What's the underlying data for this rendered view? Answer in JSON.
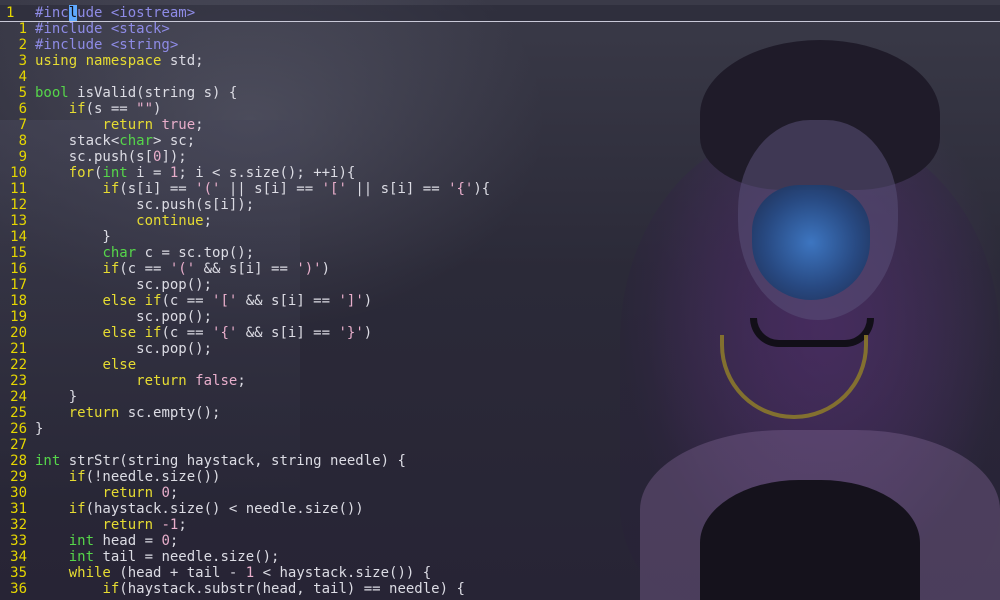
{
  "editor": {
    "colors": {
      "line_number": "#e5d600",
      "preprocessor": "#8e8be6",
      "keyword": "#e6dc32",
      "type": "#56d64a",
      "string": "#e8aecb",
      "plain": "#dcdce4",
      "cursor": "#5fa9ff"
    },
    "current_line": 0,
    "cursor": {
      "line": 0,
      "column": 6
    },
    "lines": [
      {
        "num": "1",
        "tokens": [
          [
            "pre",
            "#inc"
          ],
          [
            "cur",
            "l"
          ],
          [
            "pre",
            "ude <iostream>"
          ]
        ]
      },
      {
        "num": "1",
        "tokens": [
          [
            "pre",
            "#include <stack>"
          ]
        ]
      },
      {
        "num": "2",
        "tokens": [
          [
            "pre",
            "#include <string>"
          ]
        ]
      },
      {
        "num": "3",
        "tokens": [
          [
            "kw",
            "using"
          ],
          [
            "pl",
            " "
          ],
          [
            "kw",
            "namespace"
          ],
          [
            "pl",
            " std;"
          ]
        ]
      },
      {
        "num": "4",
        "tokens": []
      },
      {
        "num": "5",
        "tokens": [
          [
            "ty",
            "bool"
          ],
          [
            "pl",
            " isValid(string s) {"
          ]
        ]
      },
      {
        "num": "6",
        "tokens": [
          [
            "pl",
            "    "
          ],
          [
            "kw",
            "if"
          ],
          [
            "pl",
            "(s == "
          ],
          [
            "str",
            "\"\""
          ],
          [
            "pl",
            ")"
          ]
        ]
      },
      {
        "num": "7",
        "tokens": [
          [
            "pl",
            "        "
          ],
          [
            "kw",
            "return"
          ],
          [
            "pl",
            " "
          ],
          [
            "num",
            "true"
          ],
          [
            "pl",
            ";"
          ]
        ]
      },
      {
        "num": "8",
        "tokens": [
          [
            "pl",
            "    stack<"
          ],
          [
            "ty",
            "char"
          ],
          [
            "pl",
            "> sc;"
          ]
        ]
      },
      {
        "num": "9",
        "tokens": [
          [
            "pl",
            "    sc.push(s["
          ],
          [
            "num",
            "0"
          ],
          [
            "pl",
            "]);"
          ]
        ]
      },
      {
        "num": "10",
        "tokens": [
          [
            "pl",
            "    "
          ],
          [
            "kw",
            "for"
          ],
          [
            "pl",
            "("
          ],
          [
            "ty",
            "int"
          ],
          [
            "pl",
            " i = "
          ],
          [
            "num",
            "1"
          ],
          [
            "pl",
            "; i < s.size(); ++i){"
          ]
        ]
      },
      {
        "num": "11",
        "tokens": [
          [
            "pl",
            "        "
          ],
          [
            "kw",
            "if"
          ],
          [
            "pl",
            "(s[i] == "
          ],
          [
            "str",
            "'('"
          ],
          [
            "pl",
            " || s[i] == "
          ],
          [
            "str",
            "'['"
          ],
          [
            "pl",
            " || s[i] == "
          ],
          [
            "str",
            "'{'"
          ],
          [
            "pl",
            "){"
          ]
        ]
      },
      {
        "num": "12",
        "tokens": [
          [
            "pl",
            "            sc.push(s[i]);"
          ]
        ]
      },
      {
        "num": "13",
        "tokens": [
          [
            "pl",
            "            "
          ],
          [
            "kw",
            "continue"
          ],
          [
            "pl",
            ";"
          ]
        ]
      },
      {
        "num": "14",
        "tokens": [
          [
            "pl",
            "        }"
          ]
        ]
      },
      {
        "num": "15",
        "tokens": [
          [
            "pl",
            "        "
          ],
          [
            "ty",
            "char"
          ],
          [
            "pl",
            " c = sc.top();"
          ]
        ]
      },
      {
        "num": "16",
        "tokens": [
          [
            "pl",
            "        "
          ],
          [
            "kw",
            "if"
          ],
          [
            "pl",
            "(c == "
          ],
          [
            "str",
            "'('"
          ],
          [
            "pl",
            " && s[i] == "
          ],
          [
            "str",
            "')'"
          ],
          [
            "pl",
            ")"
          ]
        ]
      },
      {
        "num": "17",
        "tokens": [
          [
            "pl",
            "            sc.pop();"
          ]
        ]
      },
      {
        "num": "18",
        "tokens": [
          [
            "pl",
            "        "
          ],
          [
            "kw",
            "else"
          ],
          [
            "pl",
            " "
          ],
          [
            "kw",
            "if"
          ],
          [
            "pl",
            "(c == "
          ],
          [
            "str",
            "'['"
          ],
          [
            "pl",
            " && s[i] == "
          ],
          [
            "str",
            "']'"
          ],
          [
            "pl",
            ")"
          ]
        ]
      },
      {
        "num": "19",
        "tokens": [
          [
            "pl",
            "            sc.pop();"
          ]
        ]
      },
      {
        "num": "20",
        "tokens": [
          [
            "pl",
            "        "
          ],
          [
            "kw",
            "else"
          ],
          [
            "pl",
            " "
          ],
          [
            "kw",
            "if"
          ],
          [
            "pl",
            "(c == "
          ],
          [
            "str",
            "'{'"
          ],
          [
            "pl",
            " && s[i] == "
          ],
          [
            "str",
            "'}'"
          ],
          [
            "pl",
            ")"
          ]
        ]
      },
      {
        "num": "21",
        "tokens": [
          [
            "pl",
            "            sc.pop();"
          ]
        ]
      },
      {
        "num": "22",
        "tokens": [
          [
            "pl",
            "        "
          ],
          [
            "kw",
            "else"
          ]
        ]
      },
      {
        "num": "23",
        "tokens": [
          [
            "pl",
            "            "
          ],
          [
            "kw",
            "return"
          ],
          [
            "pl",
            " "
          ],
          [
            "num",
            "false"
          ],
          [
            "pl",
            ";"
          ]
        ]
      },
      {
        "num": "24",
        "tokens": [
          [
            "pl",
            "    }"
          ]
        ]
      },
      {
        "num": "25",
        "tokens": [
          [
            "pl",
            "    "
          ],
          [
            "kw",
            "return"
          ],
          [
            "pl",
            " sc.empty();"
          ]
        ]
      },
      {
        "num": "26",
        "tokens": [
          [
            "pl",
            "}"
          ]
        ]
      },
      {
        "num": "27",
        "tokens": []
      },
      {
        "num": "28",
        "tokens": [
          [
            "ty",
            "int"
          ],
          [
            "pl",
            " strStr(string haystack, string needle) {"
          ]
        ]
      },
      {
        "num": "29",
        "tokens": [
          [
            "pl",
            "    "
          ],
          [
            "kw",
            "if"
          ],
          [
            "pl",
            "(!needle.size())"
          ]
        ]
      },
      {
        "num": "30",
        "tokens": [
          [
            "pl",
            "        "
          ],
          [
            "kw",
            "return"
          ],
          [
            "pl",
            " "
          ],
          [
            "num",
            "0"
          ],
          [
            "pl",
            ";"
          ]
        ]
      },
      {
        "num": "31",
        "tokens": [
          [
            "pl",
            "    "
          ],
          [
            "kw",
            "if"
          ],
          [
            "pl",
            "(haystack.size() < needle.size())"
          ]
        ]
      },
      {
        "num": "32",
        "tokens": [
          [
            "pl",
            "        "
          ],
          [
            "kw",
            "return"
          ],
          [
            "pl",
            " "
          ],
          [
            "num",
            "-1"
          ],
          [
            "pl",
            ";"
          ]
        ]
      },
      {
        "num": "33",
        "tokens": [
          [
            "pl",
            "    "
          ],
          [
            "ty",
            "int"
          ],
          [
            "pl",
            " head = "
          ],
          [
            "num",
            "0"
          ],
          [
            "pl",
            ";"
          ]
        ]
      },
      {
        "num": "34",
        "tokens": [
          [
            "pl",
            "    "
          ],
          [
            "ty",
            "int"
          ],
          [
            "pl",
            " tail = needle.size();"
          ]
        ]
      },
      {
        "num": "35",
        "tokens": [
          [
            "pl",
            "    "
          ],
          [
            "kw",
            "while"
          ],
          [
            "pl",
            " (head + tail - "
          ],
          [
            "num",
            "1"
          ],
          [
            "pl",
            " < haystack.size()) {"
          ]
        ]
      },
      {
        "num": "36",
        "tokens": [
          [
            "pl",
            "        "
          ],
          [
            "kw",
            "if"
          ],
          [
            "pl",
            "(haystack.substr(head, tail) == needle) {"
          ]
        ]
      }
    ]
  }
}
